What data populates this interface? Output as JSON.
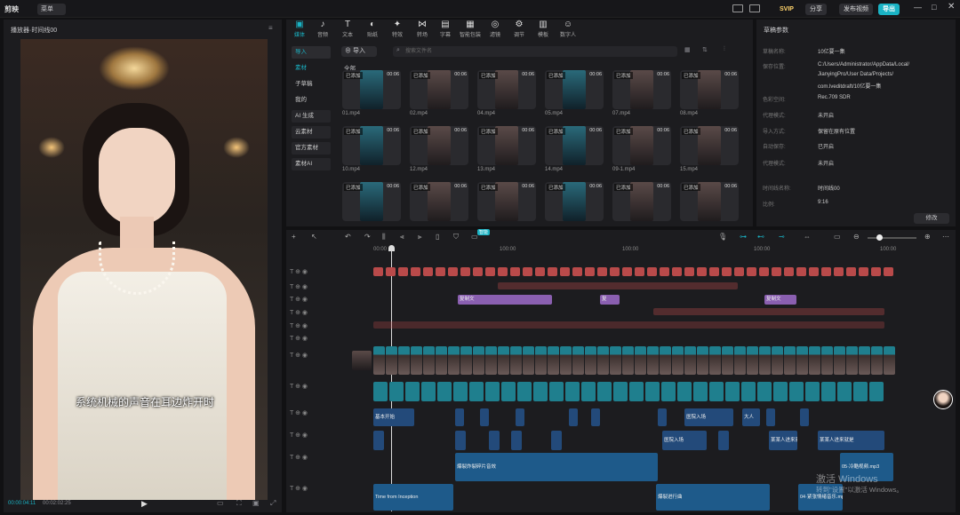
{
  "app": {
    "logo": "剪映",
    "project_menu": "菜单",
    "svip": "SVIP",
    "share": "分享",
    "publish": "发布视频",
    "export": "导出"
  },
  "player": {
    "title": "播放器·时间线00",
    "subtitle": "系统机械的声音在耳边炸开时",
    "current_time": "00:00:04:11",
    "total_time": "00:02:02:25"
  },
  "toolbar": {
    "items": [
      "媒体",
      "音频",
      "文本",
      "贴纸",
      "特效",
      "转场",
      "字幕",
      "滤镜",
      "调节",
      "模板",
      "数字人"
    ],
    "extra_items": [
      "智能包装"
    ]
  },
  "media": {
    "sidebar": [
      "导入",
      "素材",
      "子草稿",
      "我的",
      "AI 生成",
      "云素材",
      "官方素材",
      "素材AI"
    ],
    "import_label": "导入",
    "search_placeholder": "搜索文件名",
    "all_label": "全部",
    "cards": [
      {
        "name": "01.mp4",
        "tag": "已添加",
        "dur": "00:06"
      },
      {
        "name": "02.mp4",
        "tag": "已添加",
        "dur": "00:06"
      },
      {
        "name": "04.mp4",
        "tag": "已添加",
        "dur": "00:06"
      },
      {
        "name": "05.mp4",
        "tag": "已添加",
        "dur": "00:06"
      },
      {
        "name": "07.mp4",
        "tag": "已添加",
        "dur": "00:06"
      },
      {
        "name": "08.mp4",
        "tag": "已添加",
        "dur": "00:06"
      },
      {
        "name": "10.mp4",
        "tag": "已添加",
        "dur": "00:06"
      },
      {
        "name": "12.mp4",
        "tag": "已添加",
        "dur": "00:06"
      },
      {
        "name": "13.mp4",
        "tag": "已添加",
        "dur": "00:06"
      },
      {
        "name": "14.mp4",
        "tag": "已添加",
        "dur": "00:06"
      },
      {
        "name": "09-1.mp4",
        "tag": "已添加",
        "dur": "00:06"
      },
      {
        "name": "15.mp4",
        "tag": "已添加",
        "dur": "00:06"
      },
      {
        "name": "",
        "tag": "已添加",
        "dur": "00:06"
      },
      {
        "name": "",
        "tag": "已添加",
        "dur": "00:06"
      },
      {
        "name": "",
        "tag": "已添加",
        "dur": "00:06"
      },
      {
        "name": "",
        "tag": "已添加",
        "dur": "00:06"
      },
      {
        "name": "",
        "tag": "已添加",
        "dur": "00:06"
      },
      {
        "name": "",
        "tag": "已添加",
        "dur": "00:06"
      }
    ]
  },
  "props": {
    "title": "草稿参数",
    "rows": [
      {
        "k": "草稿名称:",
        "v": "10亿要一集"
      },
      {
        "k": "保存位置:",
        "v": "C:/Users/Administrator/AppData/Local/"
      },
      {
        "k": "",
        "v": "JianyingPro/User Data/Projects/"
      },
      {
        "k": "",
        "v": "com.lveditdraft/10亿要一集"
      },
      {
        "k": "色彩空间:",
        "v": "Rec.709 SDR"
      },
      {
        "k": "代理模式:",
        "v": "未开启"
      },
      {
        "k": "导入方式:",
        "v": "保留在原有位置"
      },
      {
        "k": "自动保存:",
        "v": "已开启"
      },
      {
        "k": "代理模式:",
        "v": "未开启"
      },
      {
        "k": "时间线名称:",
        "v": "时间线00"
      },
      {
        "k": "比例:",
        "v": "9:16"
      }
    ],
    "edit": "修改"
  },
  "timeline": {
    "ruler": [
      "00:00",
      "100:00",
      "100:00",
      "100:00",
      "100:00"
    ],
    "beat_label": "智能",
    "clips": {
      "music_a": "Time from Inception",
      "music_b": "爆裂炸裂碎片音效",
      "music_c": "05·冷酷视频.mp3",
      "music_d": "爆裂进行曲",
      "music_e": "04·紧张情绪音乐.mp3",
      "purple_a": "复制文",
      "purple_b": "复",
      "purple_c": "复制文",
      "blue_a": "基本开始",
      "blue_b": "医院入场",
      "blue_c": "大人",
      "blue_d": "医院入场",
      "blue_e": "某某人进来就是",
      "blue_f": "某某人进来就是"
    }
  },
  "watermark": {
    "line1": "激活 Windows",
    "line2": "转到\"设置\"以激活 Windows。"
  }
}
